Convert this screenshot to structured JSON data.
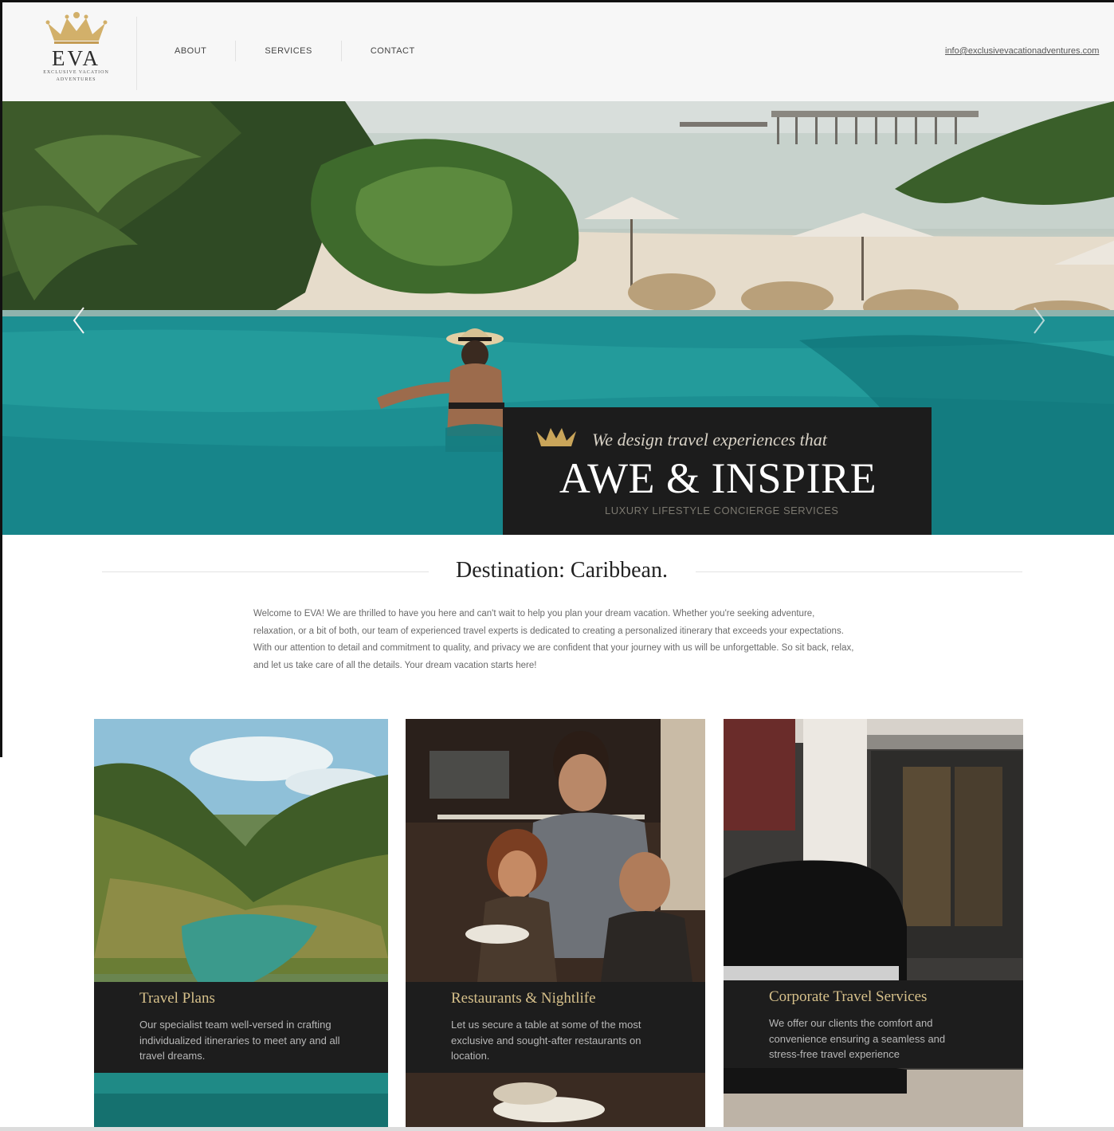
{
  "brand": {
    "name": "EVA",
    "tagline_line1": "EXCLUSIVE VACATION",
    "tagline_line2": "ADVENTURES",
    "gold": "#c9a55a"
  },
  "nav": {
    "items": [
      "ABOUT",
      "SERVICES",
      "CONTACT"
    ],
    "email": "info@exclusivevacationadventures.com"
  },
  "hero": {
    "tagline": "We design travel experiences that",
    "title": "AWE & INSPIRE",
    "subtitle": "LUXURY LIFESTYLE CONCIERGE SERVICES",
    "prev_icon": "chevron-left-icon",
    "next_icon": "chevron-right-icon"
  },
  "destination": {
    "title": "Destination: Caribbean.",
    "intro": "Welcome to EVA! We are thrilled to have you here and can't wait to help you plan your dream vacation. Whether you're seeking adventure, relaxation, or a bit of both, our team of experienced travel experts is dedicated to creating a personalized itinerary that exceeds your expectations. With our attention to detail and commitment to quality, and privacy we are confident that your journey with us will be unforgettable. So sit back, relax, and let us take care of all the details. Your dream vacation starts here!"
  },
  "cards": [
    {
      "title": "Travel Plans",
      "text": "Our specialist team well-versed in crafting individualized itineraries to meet any and all travel dreams."
    },
    {
      "title": "Restaurants & Nightlife",
      "text": "Let us secure a table at some of the most exclusive and sought-after restaurants on location."
    },
    {
      "title": "Corporate Travel Services",
      "text": "We offer our clients the comfort and convenience ensuring a seamless and stress-free travel experience"
    }
  ]
}
